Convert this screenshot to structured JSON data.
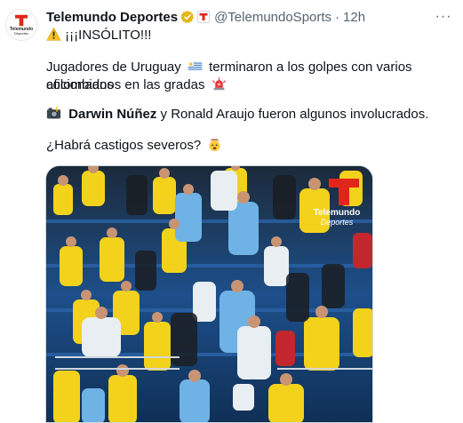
{
  "tweet": {
    "display_name": "Telemundo Deportes",
    "handle": "@TelemundoSports",
    "separator": "·",
    "time": "12h",
    "more_label": "···",
    "avatar": {
      "wordmark_top": "Telemundo",
      "wordmark_bottom": "Deportes"
    },
    "text": {
      "line1": "¡¡¡INSÓLITO!!!",
      "line2": "Jugadores de Uruguay",
      "line2b": "terminaron a los golpes con varios aficionados",
      "line3": "colombianos en las gradas",
      "line4_bold": "Darwin Núñez",
      "line4_rest": " y Ronald Araujo fueron algunos involucrados.",
      "line5": "¿Habrá castigos severos?"
    },
    "emojis": {
      "warning": "warning-icon",
      "uruguay_flag": "uruguay-flag-icon",
      "siren": "police-light-icon",
      "camera": "camera-flash-icon",
      "shocked": "exploding-head-icon"
    },
    "media": {
      "watermark_top": "Telemundo",
      "watermark_bottom": "Deportes"
    },
    "colors": {
      "brand_red": "#e0261b",
      "verified_gold": "#e2b719",
      "text_secondary": "#536471",
      "colombia_yellow": "#f3d21c",
      "uruguay_sky": "#6fb2e6"
    }
  }
}
